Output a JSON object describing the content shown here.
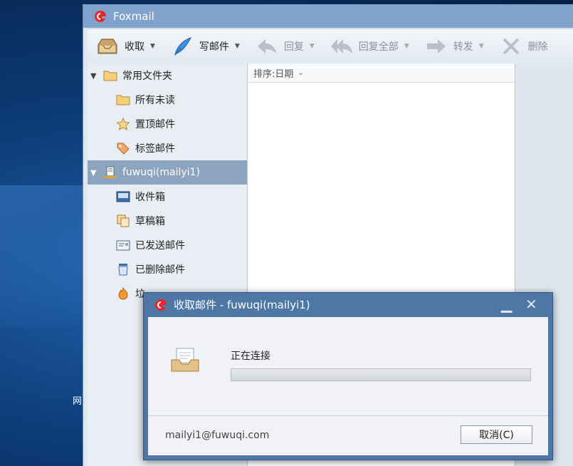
{
  "desktop": {
    "side_label": "网"
  },
  "window": {
    "title": "Foxmail"
  },
  "toolbar": {
    "receive": "收取",
    "compose": "写邮件",
    "reply": "回复",
    "reply_all": "回复全部",
    "forward": "转发",
    "delete": "删除"
  },
  "sidebar": {
    "common_folders": {
      "label": "常用文件夹",
      "items": [
        {
          "label": "所有未读",
          "icon": "folder-icon"
        },
        {
          "label": "置顶邮件",
          "icon": "star-icon"
        },
        {
          "label": "标签邮件",
          "icon": "tag-icon"
        }
      ]
    },
    "account": {
      "label": "fuwuqi(mailyi1)",
      "items": [
        {
          "label": "收件箱",
          "icon": "inbox-icon"
        },
        {
          "label": "草稿箱",
          "icon": "drafts-icon"
        },
        {
          "label": "已发送邮件",
          "icon": "sent-icon"
        },
        {
          "label": "已删除邮件",
          "icon": "trash-icon"
        },
        {
          "label": "垃",
          "icon": "junk-icon"
        }
      ]
    }
  },
  "list": {
    "sort_label": "排序:日期"
  },
  "dialog": {
    "title": "收取邮件 - fuwuqi(mailyi1)",
    "status": "正在连接",
    "progress": 0,
    "email": "mailyi1@fuwuqi.com",
    "cancel_label": "取消(C)"
  },
  "colors": {
    "titlebar": "#7fa3cc",
    "dialog_frame": "#4e77a6",
    "selected_row": "#8ca4bf"
  }
}
